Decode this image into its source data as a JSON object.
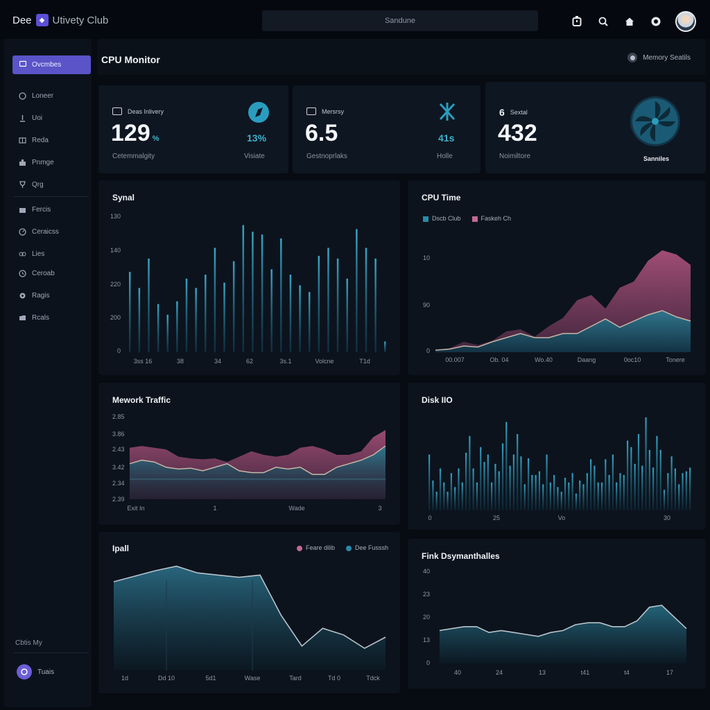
{
  "header": {
    "brand_left": "Dee",
    "brand_right": "Utivety Club",
    "search_text": "Sandune",
    "icons": [
      "timer-icon",
      "search-icon",
      "home-icon",
      "circle-icon"
    ]
  },
  "sidebar": {
    "active": "Ovcmbes",
    "items": [
      "Loneer",
      "Uoi",
      "Reda",
      "Pnmge",
      "Qrg",
      "Fercis",
      "Ceraicss",
      "Lies",
      "Ceroab",
      "Ragis",
      "Rcals"
    ],
    "footer": "Cbtis My",
    "user": "Tuais"
  },
  "page": {
    "title": "CPU Monitor",
    "toggle_label": "Memory Seatils"
  },
  "stats": [
    {
      "label": "Deas Inlivery",
      "value": "129",
      "unit": "%",
      "sub": "Cetemmalgity",
      "right_value": "13%",
      "right_label": "Visiate"
    },
    {
      "label": "Mersrsy",
      "value": "6.5",
      "unit": "",
      "sub": "Gestnoprlaks",
      "right_value": "41s",
      "right_label": "Holle"
    },
    {
      "label": "Sextal",
      "prefix": "6",
      "value": "432",
      "unit": "",
      "sub": "Noimiltore",
      "right_label": "Sanniles"
    }
  ],
  "panels": {
    "synal": {
      "title": "Synal",
      "y_ticks": [
        "130",
        "140",
        "220",
        "200",
        "0"
      ],
      "x_ticks": [
        "3ss 16",
        "38",
        "34",
        "62",
        "3s.1",
        "Volcne",
        "T1d"
      ],
      "bars": [
        60,
        48,
        70,
        36,
        28,
        38,
        55,
        48,
        58,
        78,
        52,
        68,
        95,
        90,
        88,
        62,
        85,
        58,
        50,
        45,
        72,
        78,
        70,
        55,
        92,
        78,
        70,
        8
      ]
    },
    "cpu_time": {
      "title": "CPU Time",
      "legend": [
        "Dscb Club",
        "Faskeh Ch"
      ],
      "y_ticks": [
        "10",
        "90",
        "0"
      ],
      "x_ticks": [
        "00.007",
        "Ob. 04",
        "Wo.40",
        "Daang",
        "0oc10",
        "Tonere"
      ],
      "series_pink": [
        2,
        4,
        10,
        7,
        11,
        20,
        22,
        15,
        25,
        33,
        50,
        55,
        42,
        62,
        68,
        88,
        98,
        94,
        84
      ],
      "series_teal": [
        2,
        3,
        6,
        5,
        10,
        14,
        18,
        14,
        14,
        18,
        18,
        25,
        32,
        24,
        30,
        36,
        40,
        34,
        30
      ]
    },
    "network": {
      "title": "Mework Traffic",
      "y_ticks": [
        "2.85",
        "3.86",
        "2.43",
        "3.42",
        "2.34",
        "2.39"
      ],
      "x_ticks": [
        "Exit In",
        "1",
        "Wade",
        "3"
      ],
      "series_pink": [
        58,
        60,
        58,
        56,
        48,
        46,
        45,
        46,
        42,
        48,
        54,
        50,
        48,
        50,
        58,
        60,
        56,
        50,
        50,
        54,
        70,
        78
      ],
      "series_teal": [
        40,
        44,
        42,
        36,
        34,
        35,
        32,
        36,
        40,
        32,
        30,
        30,
        36,
        34,
        36,
        28,
        28,
        36,
        40,
        44,
        50,
        60
      ]
    },
    "disk_io": {
      "title": "Disk IIO",
      "x_ticks": [
        "0",
        "25",
        "Vo",
        "30"
      ],
      "bars": [
        60,
        32,
        20,
        45,
        30,
        20,
        40,
        25,
        45,
        30,
        62,
        80,
        45,
        30,
        68,
        52,
        60,
        30,
        50,
        42,
        72,
        95,
        48,
        60,
        82,
        58,
        28,
        56,
        38,
        38,
        42,
        28,
        60,
        30,
        38,
        25,
        20,
        35,
        30,
        40,
        18,
        32,
        28,
        40,
        55,
        48,
        30,
        30,
        55,
        38,
        60,
        30,
        40,
        38,
        75,
        68,
        50,
        82,
        48,
        100,
        65,
        46,
        80,
        65,
        22,
        40,
        58,
        45,
        28,
        40,
        42,
        46
      ],
      "series_teal": []
    },
    "ipall": {
      "title": "Ipall",
      "legend": [
        "Feare dilib",
        "Dee Fusssh"
      ],
      "x_ticks": [
        "1d",
        "Dd 10",
        "5d1",
        "Wase",
        "Tard",
        "Td 0",
        "Tdck"
      ],
      "series": [
        80,
        85,
        90,
        94,
        88,
        86,
        84,
        86,
        50,
        22,
        38,
        32,
        20,
        30
      ]
    },
    "fink": {
      "title": "Fink Dsymanthalles",
      "y_ticks": [
        "40",
        "23",
        "20",
        "13",
        "0"
      ],
      "x_ticks": [
        "40",
        "24",
        "13",
        "t41",
        "t4",
        "17"
      ],
      "series": [
        34,
        36,
        38,
        38,
        32,
        34,
        32,
        30,
        28,
        32,
        34,
        40,
        42,
        42,
        38,
        38,
        44,
        58,
        60,
        48,
        36
      ]
    }
  },
  "colors": {
    "accent": "#5a54c8",
    "teal": "#2a8aa8",
    "pink": "#b0557a",
    "bg": "#070b12"
  }
}
